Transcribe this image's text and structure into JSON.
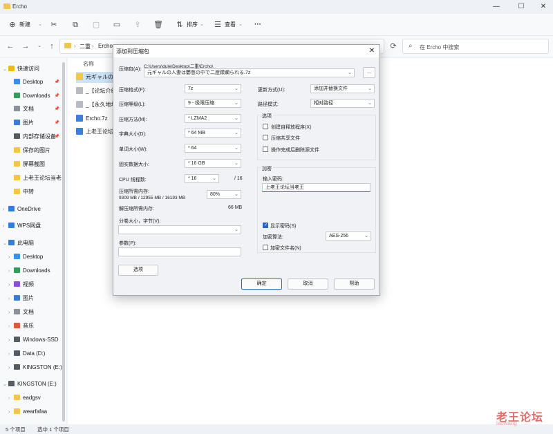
{
  "window": {
    "title": "Ercho",
    "minimize": "—",
    "maximize": "☐",
    "close": "✕"
  },
  "toolbar": {
    "new_label": "新建",
    "sort_label": "排序",
    "view_label": "查看",
    "more_label": "···"
  },
  "address": {
    "segments": [
      "二重",
      "Ercho"
    ],
    "separator": "›",
    "search_placeholder": "在 Ercho 中搜索"
  },
  "sidebar": {
    "items": [
      {
        "label": "快速访问",
        "icon": "star-icon",
        "color": "#f2b90f",
        "level": 0,
        "chev": "⌄"
      },
      {
        "label": "Desktop",
        "icon": "desktop-icon",
        "color": "#3b8ee6",
        "level": 1,
        "pin": true
      },
      {
        "label": "Downloads",
        "icon": "download-icon",
        "color": "#2f9e5b",
        "level": 1,
        "pin": true
      },
      {
        "label": "文档",
        "icon": "document-icon",
        "color": "#8a9099",
        "level": 1,
        "pin": true
      },
      {
        "label": "图片",
        "icon": "picture-icon",
        "color": "#3a7bd5",
        "level": 1,
        "pin": true
      },
      {
        "label": "内部存储设备",
        "icon": "drive-icon",
        "color": "#555b63",
        "level": 1,
        "pin": true
      },
      {
        "label": "保存的图片",
        "icon": "folder-icon",
        "color": "#f3c64b",
        "level": 1
      },
      {
        "label": "屏幕截图",
        "icon": "folder-icon",
        "color": "#f3c64b",
        "level": 1
      },
      {
        "label": "上老王论坛当老",
        "icon": "folder-icon",
        "color": "#f3c64b",
        "level": 1
      },
      {
        "label": "中转",
        "icon": "folder-icon",
        "color": "#f3c64b",
        "level": 1
      },
      {
        "label": "OneDrive",
        "icon": "cloud-icon",
        "color": "#2f7fe0",
        "level": 0,
        "chev": "›"
      },
      {
        "label": "WPS网盘",
        "icon": "cloud-icon",
        "color": "#2f7fe0",
        "level": 0,
        "chev": "›"
      },
      {
        "label": "此电脑",
        "icon": "computer-icon",
        "color": "#3a7bd5",
        "level": 0,
        "chev": "⌄"
      },
      {
        "label": "Desktop",
        "icon": "desktop-icon",
        "color": "#3b8ee6",
        "level": 1,
        "chev": "›"
      },
      {
        "label": "Downloads",
        "icon": "download-icon",
        "color": "#2f9e5b",
        "level": 1,
        "chev": "›"
      },
      {
        "label": "视频",
        "icon": "video-icon",
        "color": "#8b4fd1",
        "level": 1,
        "chev": "›"
      },
      {
        "label": "图片",
        "icon": "picture-icon",
        "color": "#3a7bd5",
        "level": 1,
        "chev": "›"
      },
      {
        "label": "文档",
        "icon": "document-icon",
        "color": "#8a9099",
        "level": 1,
        "chev": "›"
      },
      {
        "label": "音乐",
        "icon": "music-icon",
        "color": "#e2573b",
        "level": 1,
        "chev": "›"
      },
      {
        "label": "Windows-SSD",
        "icon": "drive-icon",
        "color": "#555b63",
        "level": 1,
        "chev": "›"
      },
      {
        "label": "Data (D:)",
        "icon": "drive-icon",
        "color": "#555b63",
        "level": 1,
        "chev": "›"
      },
      {
        "label": "KINGSTON (E:)",
        "icon": "drive-icon",
        "color": "#555b63",
        "level": 1,
        "chev": "›"
      },
      {
        "label": "KINGSTON (E:)",
        "icon": "drive-icon",
        "color": "#555b63",
        "level": 0,
        "chev": "⌄"
      },
      {
        "label": "eadgsv",
        "icon": "folder-icon",
        "color": "#f3c64b",
        "level": 1,
        "chev": "›"
      },
      {
        "label": "wearfafaa",
        "icon": "folder-icon",
        "color": "#f3c64b",
        "level": 1,
        "chev": "›"
      }
    ]
  },
  "content": {
    "column_name": "名称",
    "files": [
      {
        "name": "元ギャルの人",
        "icon": "folder-icon",
        "color": "#f3c64b",
        "selected": true
      },
      {
        "name": "_【论坛介绍",
        "icon": "file-icon",
        "color": "#b8bcc2"
      },
      {
        "name": "_【永久地址",
        "icon": "file-icon",
        "color": "#b8bcc2"
      },
      {
        "name": "Ercho.7z",
        "icon": "archive-icon",
        "color": "#3b7fd8"
      },
      {
        "name": "上老王论坛",
        "icon": "archive-icon",
        "color": "#3b7fd8"
      }
    ]
  },
  "status": {
    "count": "5 个项目",
    "selected": "选中 1 个项目"
  },
  "watermark": {
    "text": "老王论坛",
    "sub": "laowang"
  },
  "dialog": {
    "title": "添加到压缩包",
    "close": "✕",
    "archive_label": "压缩包(A):",
    "archive_path": "C:\\Users\\dule\\Desktop\\二重\\Ercho\\",
    "archive_name": "元ギャルの人妻は鬱憋の中で二度蹂躙られる.7z",
    "browse_label": "...",
    "format_label": "压缩格式(F):",
    "format_value": "7z",
    "level_label": "压缩等级(L):",
    "level_value": "9 - 极限压缩",
    "method_label": "压缩方法(M):",
    "method_value": "* LZMA2",
    "dict_label": "字典大小(D):",
    "dict_value": "* 64 MB",
    "word_label": "单词大小(W):",
    "word_value": "* 64",
    "solid_label": "固实数据大小:",
    "solid_value": "* 16 GB",
    "threads_label": "CPU 线程数:",
    "threads_value": "* 16",
    "threads_max": "/ 16",
    "mem_label": "压缩所需内存:",
    "mem_detail": "9309 MB / 12955 MB / 16193 MB",
    "mem_percent": "80%",
    "decomp_label": "解压缩所需内存:",
    "decomp_value": "66 MB",
    "split_label": "分卷大小，字节(V):",
    "split_value": "",
    "params_label": "参数(P):",
    "params_value": "",
    "options_btn": "选项",
    "update_label": "更新方式(U):",
    "update_value": "添加并替换文件",
    "path_label": "路径模式:",
    "path_value": "相对路径",
    "options_group": "选项",
    "opt_sfx": "创建自释放程序(X)",
    "opt_shared": "压缩共享文件",
    "opt_delete": "操作完成后删除源文件",
    "encrypt_group": "加密",
    "password_label": "输入密码:",
    "password_value": "上老王论坛当老王",
    "show_password": "显示密码(S)",
    "enc_method_label": "加密算法:",
    "enc_method_value": "AES-256",
    "encrypt_names": "加密文件名(N)",
    "ok_btn": "确定",
    "cancel_btn": "取消",
    "help_btn": "帮助"
  }
}
